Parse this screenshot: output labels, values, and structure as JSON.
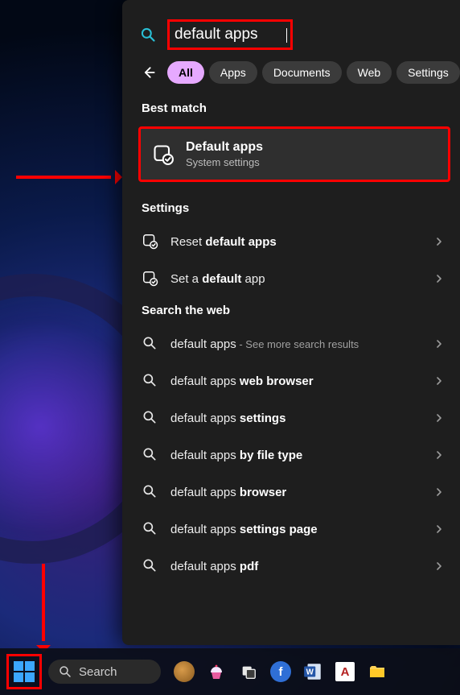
{
  "search": {
    "value": "default apps"
  },
  "filters": {
    "all": "All",
    "apps": "Apps",
    "documents": "Documents",
    "web": "Web",
    "settings": "Settings"
  },
  "sections": {
    "best_match": "Best match",
    "settings": "Settings",
    "search_web": "Search the web"
  },
  "best_match": {
    "title": "Default apps",
    "subtitle": "System settings"
  },
  "settings_results": [
    {
      "prefix": "Reset ",
      "bold": "default apps",
      "suffix": ""
    },
    {
      "prefix": "Set a ",
      "bold": "default",
      "suffix": " app"
    }
  ],
  "web_results": [
    {
      "prefix": "default apps",
      "bold": "",
      "suffix": "",
      "more": " - See more search results"
    },
    {
      "prefix": "default apps ",
      "bold": "web browser",
      "suffix": ""
    },
    {
      "prefix": "default apps ",
      "bold": "settings",
      "suffix": ""
    },
    {
      "prefix": "default apps ",
      "bold": "by file type",
      "suffix": ""
    },
    {
      "prefix": "default apps ",
      "bold": "browser",
      "suffix": ""
    },
    {
      "prefix": "default apps ",
      "bold": "settings page",
      "suffix": ""
    },
    {
      "prefix": "default apps ",
      "bold": "pdf",
      "suffix": ""
    }
  ],
  "taskbar": {
    "search_placeholder": "Search"
  },
  "colors": {
    "annotation": "#ff0000",
    "pill_active_bg": "#e6a9ff"
  }
}
